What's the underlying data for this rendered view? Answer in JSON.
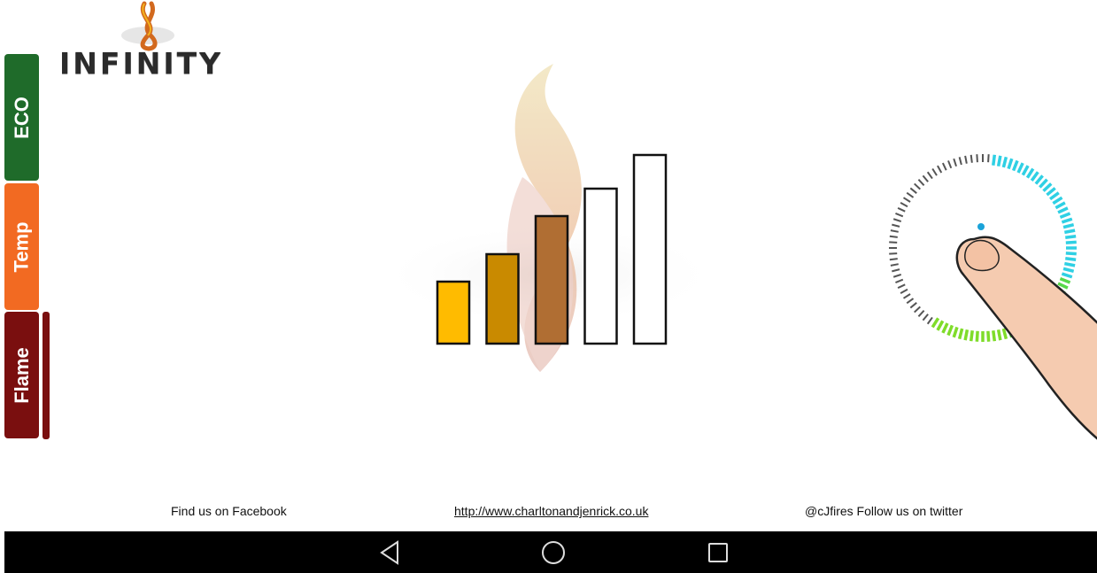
{
  "brand": {
    "logo_text": "INFINITY",
    "logo_icon": "flame-logo-icon"
  },
  "tabs": [
    {
      "label": "ECO",
      "color": "#1f6b2a"
    },
    {
      "label": "Temp",
      "color": "#f26a22"
    },
    {
      "label": "Flame",
      "color": "#7a0f0f",
      "selected": true
    }
  ],
  "flame_level": {
    "value": 3,
    "max": 5,
    "filled_colors": [
      "#ffbb00",
      "#c98a00",
      "#b06e33"
    ]
  },
  "dial": {
    "icon": "rotary-dial-icon",
    "hint_icon": "finger-pointer-icon"
  },
  "footer": {
    "facebook": "Find us on Facebook",
    "website": "http://www.charltonandjenrick.co.uk",
    "twitter": "@cJfires Follow us on twitter"
  },
  "system_nav": {
    "back_icon": "back-triangle-icon",
    "home_icon": "home-circle-icon",
    "recents_icon": "recents-square-icon"
  }
}
